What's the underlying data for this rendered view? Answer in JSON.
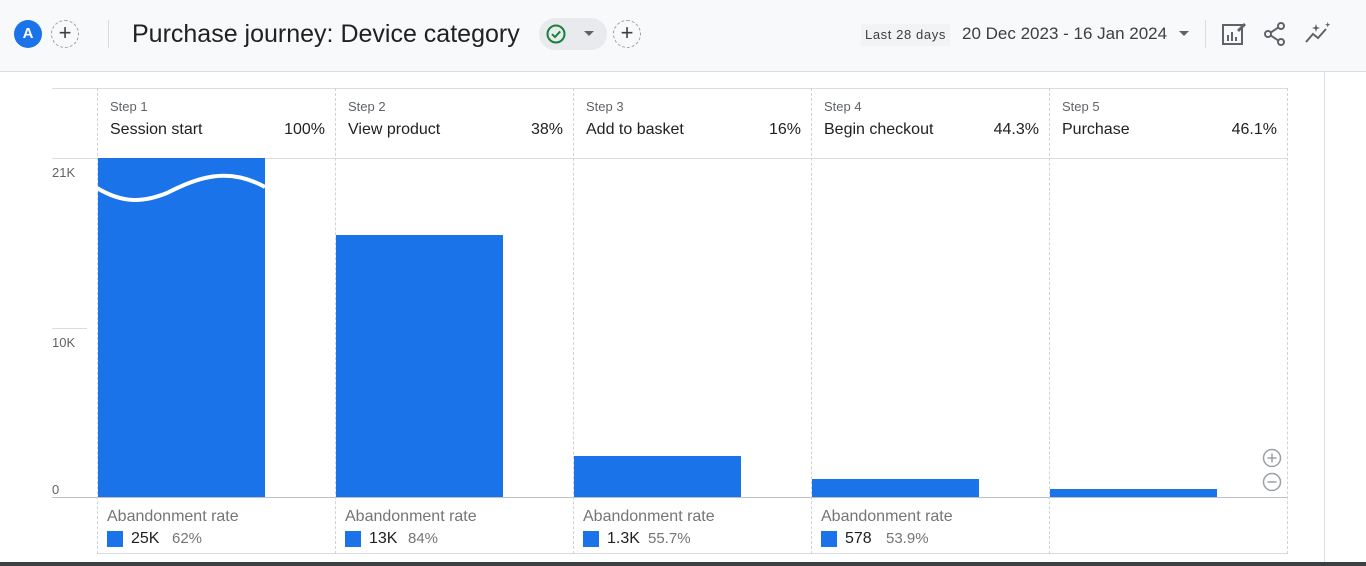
{
  "header": {
    "avatar_letter": "A",
    "title": "Purchase journey: Device category",
    "date_label": "Last 28 days",
    "date_range": "20 Dec 2023 - 16 Jan 2024",
    "add_symbol": "+"
  },
  "icons": [
    "plus-icon",
    "check-circle-icon",
    "caret-down-icon",
    "edit-chart-icon",
    "share-icon",
    "insights-icon",
    "zoom-in-icon",
    "zoom-out-icon"
  ],
  "colors": {
    "accent": "#1a73e8",
    "check": "#188038"
  },
  "chart_data": {
    "type": "bar",
    "y_ticks": [
      "21K",
      "10K",
      "0"
    ],
    "ylim": [
      0,
      21000
    ],
    "y_axis_break": true,
    "categories": [
      "Session start",
      "View product",
      "Add to basket",
      "Begin checkout",
      "Purchase"
    ],
    "values": [
      25000,
      15500,
      2450,
      1050,
      470
    ],
    "steps": [
      {
        "label": "Step 1",
        "name": "Session start",
        "pct": "100%"
      },
      {
        "label": "Step 2",
        "name": "View product",
        "pct": "38%"
      },
      {
        "label": "Step 3",
        "name": "Add to basket",
        "pct": "16%"
      },
      {
        "label": "Step 4",
        "name": "Begin checkout",
        "pct": "44.3%"
      },
      {
        "label": "Step 5",
        "name": "Purchase",
        "pct": "46.1%"
      }
    ],
    "abandonment": [
      {
        "title": "Abandonment rate",
        "count": "25K",
        "rate": "62%"
      },
      {
        "title": "Abandonment rate",
        "count": "13K",
        "rate": "84%"
      },
      {
        "title": "Abandonment rate",
        "count": "1.3K",
        "rate": "55.7%"
      },
      {
        "title": "Abandonment rate",
        "count": "578",
        "rate": "53.9%"
      }
    ]
  }
}
